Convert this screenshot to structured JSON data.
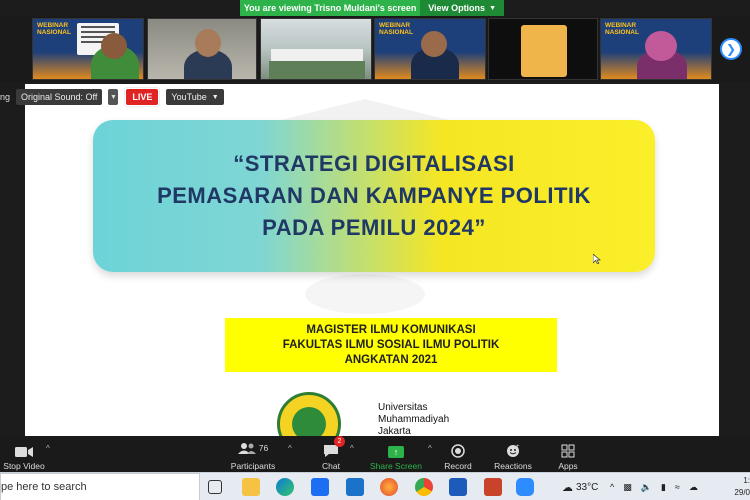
{
  "banner": {
    "message": "You are viewing Trisno Muldani's screen",
    "view_options": "View Options"
  },
  "thumbnails": {
    "webinar_label_1": "WEBINAR",
    "webinar_label_2": "NASIONAL"
  },
  "controls": {
    "recording_partial": "ng",
    "original_sound": "Original Sound: Off",
    "live": "LIVE",
    "youtube": "YouTube"
  },
  "slide": {
    "title_line1": "“STRATEGI DIGITALISASI",
    "title_line2": "PEMASARAN DAN KAMPANYE POLITIK",
    "title_line3": "PADA PEMILU 2024”",
    "sub_line1": "MAGISTER ILMU KOMUNIKASI",
    "sub_line2": "FAKULTAS ILMU SOSIAL ILMU POLITIK",
    "sub_line3": "ANGKATAN 2021",
    "univ_line1": "Universitas",
    "univ_line2": "Muhammadiyah",
    "univ_line3": "Jakarta"
  },
  "toolbar": {
    "stop_video": "Stop Video",
    "participants": "Participants",
    "participants_count": "76",
    "chat": "Chat",
    "chat_badge": "2",
    "share_screen": "Share Screen",
    "record": "Record",
    "reactions": "Reactions",
    "apps": "Apps"
  },
  "taskbar": {
    "search_placeholder": "pe here to search",
    "temperature": "33°C",
    "clock_time": "1:",
    "clock_date": "29/0"
  },
  "colors": {
    "zoom_green": "#2db34a",
    "zoom_blue": "#2d8cff",
    "title_blue": "#1f3864",
    "live_red": "#e02424"
  }
}
